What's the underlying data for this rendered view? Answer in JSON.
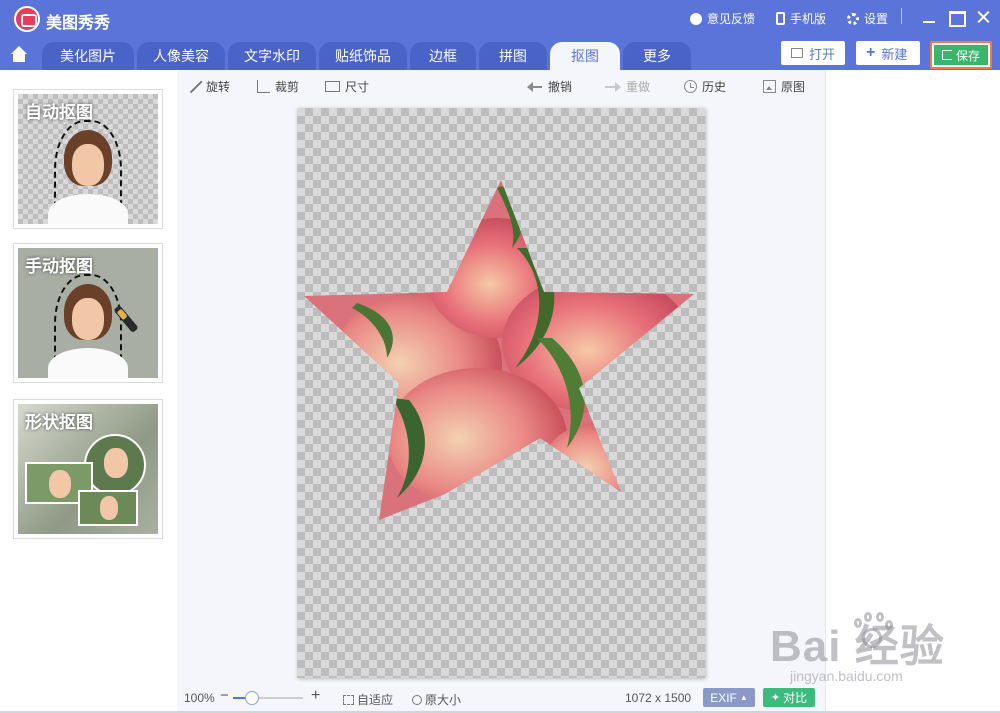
{
  "app": {
    "title": "美图秀秀"
  },
  "titlebar": {
    "feedback": "意见反馈",
    "mobile": "手机版",
    "settings": "设置"
  },
  "tabs": [
    {
      "label": "美化图片",
      "active": false
    },
    {
      "label": "人像美容",
      "active": false
    },
    {
      "label": "文字水印",
      "active": false
    },
    {
      "label": "贴纸饰品",
      "active": false
    },
    {
      "label": "边框",
      "active": false
    },
    {
      "label": "拼图",
      "active": false
    },
    {
      "label": "抠图",
      "active": true
    },
    {
      "label": "更多",
      "active": false
    }
  ],
  "actions": {
    "open": "打开",
    "new": "新建",
    "save": "保存"
  },
  "left_panel": {
    "cards": [
      {
        "label": "自动抠图"
      },
      {
        "label": "手动抠图"
      },
      {
        "label": "形状抠图"
      }
    ]
  },
  "toolbar": {
    "rotate": "旋转",
    "crop": "裁剪",
    "size": "尺寸",
    "undo": "撤销",
    "redo": "重做",
    "history": "历史",
    "original": "原图"
  },
  "statusbar": {
    "zoom": "100%",
    "zoom_level": 0.27,
    "fit": "自适应",
    "actual_size": "原大小",
    "dimensions": "1072 x 1500",
    "exif": "EXIF",
    "compare": "对比"
  },
  "watermark": {
    "logo": "Bai  经验",
    "url": "jingyan.baidu.com"
  },
  "colors": {
    "brand": "#5a74d9",
    "save_green": "#39b56d",
    "save_highlight": "#f47c38",
    "compare_green": "#3dbb7c"
  }
}
